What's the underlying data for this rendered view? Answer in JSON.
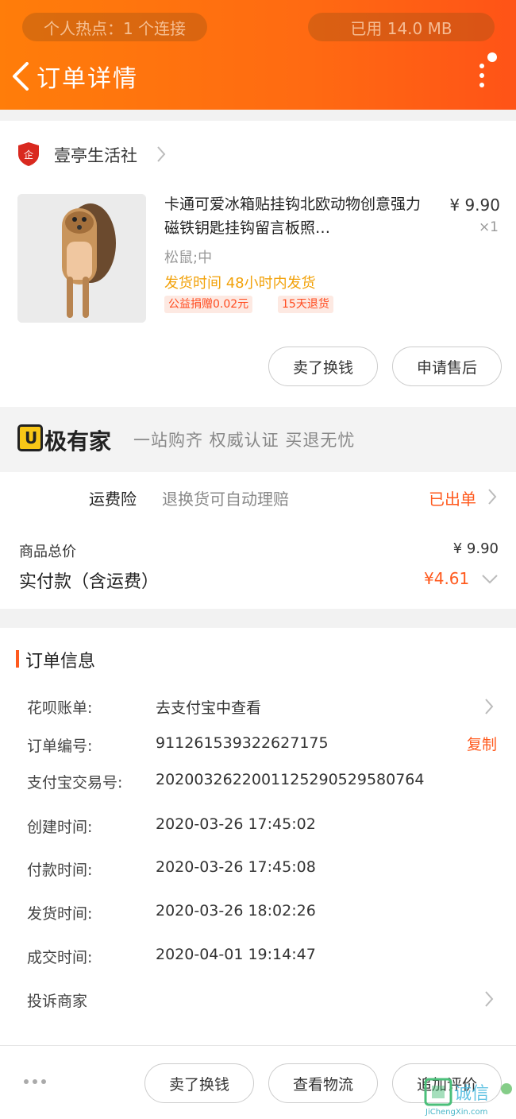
{
  "status_bar": {
    "hotspot": "个人热点：1 个连接",
    "data_used": "已用 14.0 MB"
  },
  "header": {
    "title": "订单详情"
  },
  "store": {
    "name": "壹亭生活社"
  },
  "product": {
    "title": "卡通可爱冰箱贴挂钩北欧动物创意强力磁铁钥匙挂钩留言板照…",
    "price": "¥ 9.90",
    "quantity": "×1",
    "sku": "松鼠;中",
    "shipping_time": "发货时间 48小时内发货",
    "tags": [
      "公益捐赠0.02元",
      "15天退货"
    ],
    "buttons": [
      "卖了换钱",
      "申请售后"
    ]
  },
  "brand": {
    "logo_char": "U",
    "name": "极有家",
    "slogan": "一站购齐 权威认证 买退无忧"
  },
  "insurance": {
    "label": "运费险",
    "desc": "退换货可自动理赔",
    "status": "已出单"
  },
  "totals": {
    "goods_total_label": "商品总价",
    "goods_total_value": "¥ 9.90",
    "paid_label": "实付款（含运费）",
    "paid_value": "¥4.61"
  },
  "order_info": {
    "title": "订单信息",
    "rows": [
      {
        "label": "花呗账单:",
        "value": "去支付宝中查看"
      },
      {
        "label": "订单编号:",
        "value": "911261539322627175"
      },
      {
        "label": "支付宝交易号:",
        "value": "2020032622001125290529580764"
      },
      {
        "label": "创建时间:",
        "value": "2020-03-26 17:45:02"
      },
      {
        "label": "付款时间:",
        "value": "2020-03-26 17:45:08"
      },
      {
        "label": "发货时间:",
        "value": "2020-03-26 18:02:26"
      },
      {
        "label": "成交时间:",
        "value": "2020-04-01 19:14:47"
      },
      {
        "label": "投诉商家",
        "value": ""
      }
    ],
    "copy_label": "复制"
  },
  "bottom_bar": {
    "buttons": [
      "卖了换钱",
      "查看物流",
      "追加评价"
    ]
  },
  "watermark": {
    "text": "诚信",
    "sub": "JiChengXin.com"
  },
  "colors": {
    "accent": "#ff5a1e",
    "header_orange": "#ff6a12",
    "ship_text": "#f2a20a"
  }
}
